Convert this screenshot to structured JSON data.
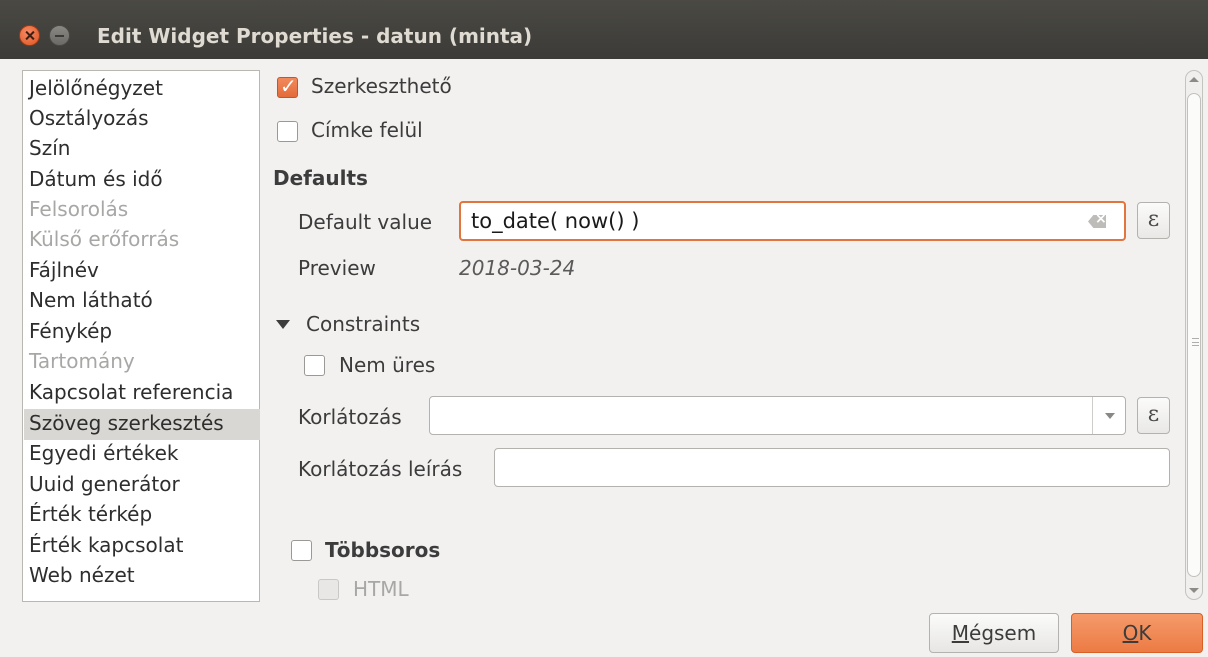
{
  "window": {
    "title": "Edit Widget Properties - datun (minta)"
  },
  "sidebar": {
    "items": [
      {
        "label": "Jelölőnégyzet",
        "disabled": false
      },
      {
        "label": "Osztályozás",
        "disabled": false
      },
      {
        "label": "Szín",
        "disabled": false
      },
      {
        "label": "Dátum és idő",
        "disabled": false
      },
      {
        "label": "Felsorolás",
        "disabled": true
      },
      {
        "label": "Külső erőforrás",
        "disabled": true
      },
      {
        "label": "Fájlnév",
        "disabled": false
      },
      {
        "label": "Nem látható",
        "disabled": false
      },
      {
        "label": "Fénykép",
        "disabled": false
      },
      {
        "label": "Tartomány",
        "disabled": true
      },
      {
        "label": "Kapcsolat referencia",
        "disabled": false
      },
      {
        "label": "Szöveg szerkesztés",
        "disabled": false,
        "selected": true
      },
      {
        "label": "Egyedi értékek",
        "disabled": false
      },
      {
        "label": "Uuid generátor",
        "disabled": false
      },
      {
        "label": "Érték térkép",
        "disabled": false
      },
      {
        "label": "Érték kapcsolat",
        "disabled": false
      },
      {
        "label": "Web nézet",
        "disabled": false
      }
    ]
  },
  "options": {
    "editable_label": "Szerkeszthető",
    "editable_checked": true,
    "label_on_top_label": "Címke felül",
    "label_on_top_checked": false
  },
  "defaults": {
    "section_title": "Defaults",
    "default_value_label": "Default value",
    "default_value": "to_date( now() )",
    "preview_label": "Preview",
    "preview_value": "2018-03-24",
    "expression_icon": "ε"
  },
  "constraints": {
    "section_title": "Constraints",
    "not_null_label": "Nem üres",
    "not_null_checked": false,
    "constraint_label": "Korlátozás",
    "constraint_value": "",
    "constraint_desc_label": "Korlátozás leírás",
    "constraint_desc_value": ""
  },
  "multiline": {
    "label": "Többsoros",
    "checked": false,
    "html_label": "HTML",
    "html_disabled": true
  },
  "buttons": {
    "cancel_label": "Mégsem",
    "ok_label": "OK"
  }
}
